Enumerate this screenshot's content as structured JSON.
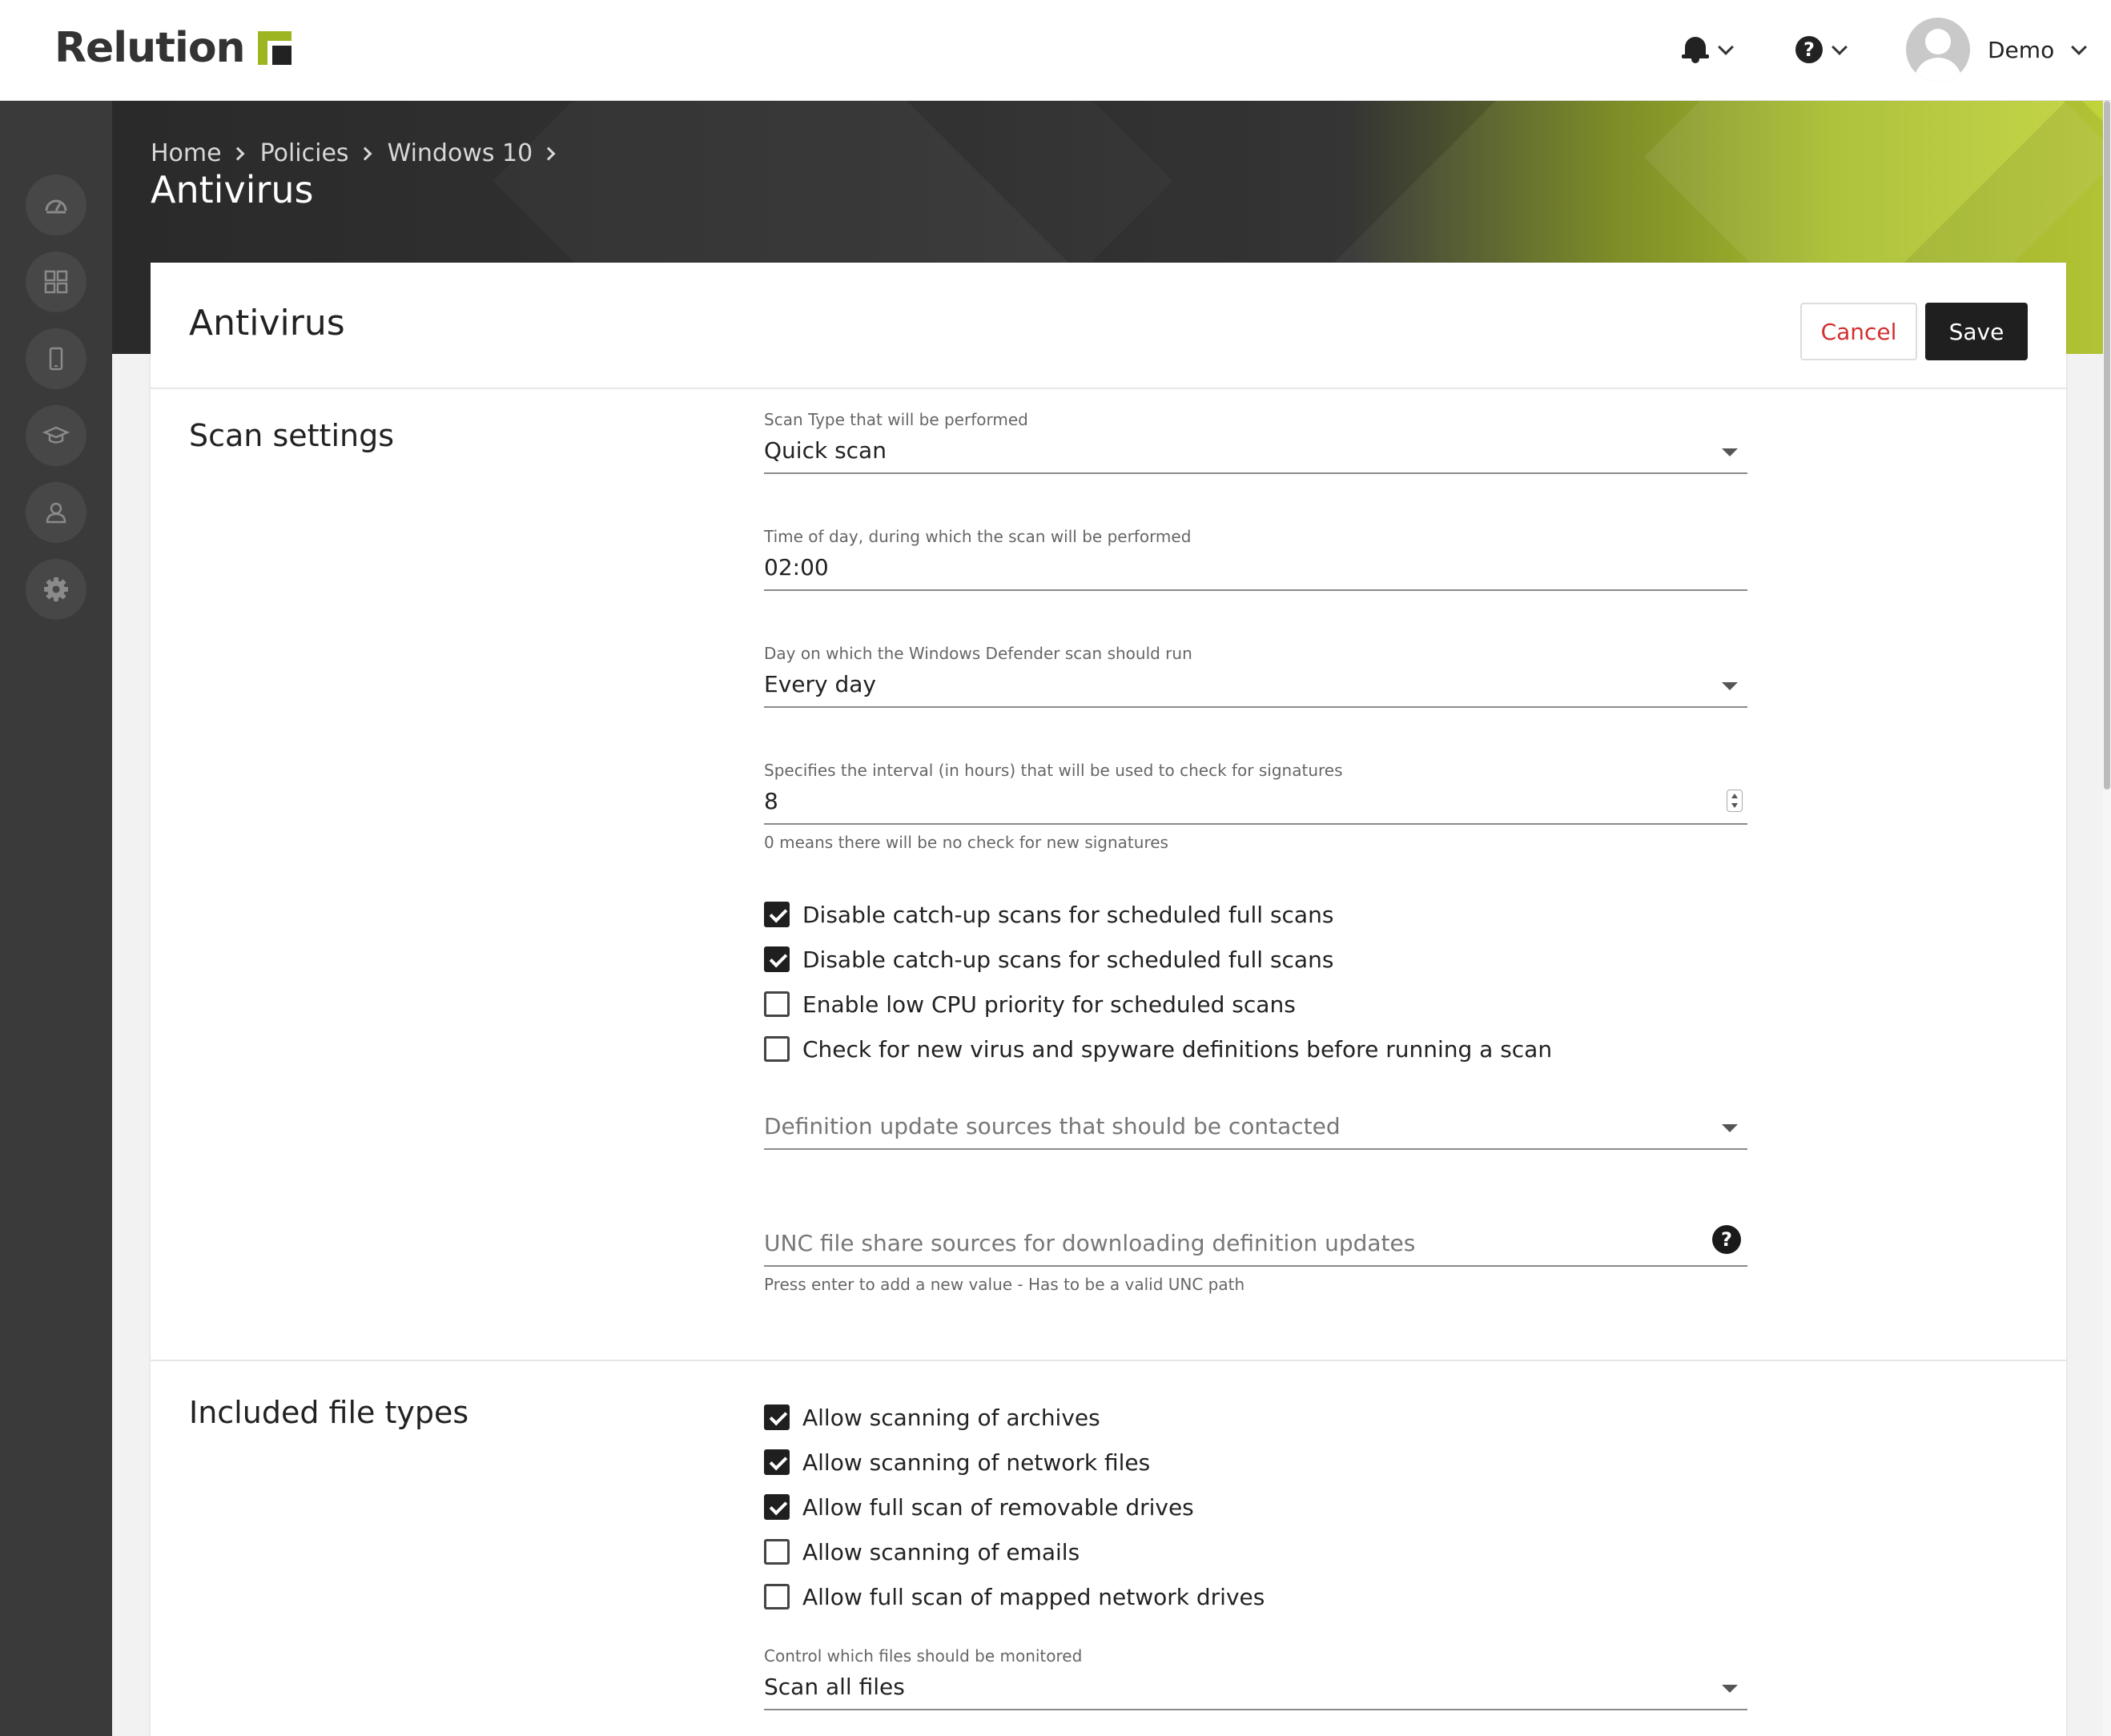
{
  "brand": {
    "name": "Relution"
  },
  "topbar": {
    "user_name": "Demo"
  },
  "breadcrumb": [
    "Home",
    "Policies",
    "Windows 10"
  ],
  "page_title": "Antivirus",
  "card": {
    "title": "Antivirus",
    "cancel_label": "Cancel",
    "save_label": "Save"
  },
  "scan_settings": {
    "title": "Scan settings",
    "scan_type": {
      "label": "Scan Type that will be performed",
      "value": "Quick scan"
    },
    "time_of_day": {
      "label": "Time of day, during which the scan will be performed",
      "value": "02:00"
    },
    "scan_day": {
      "label": "Day on which the Windows Defender scan should run",
      "value": "Every day"
    },
    "signature_interval": {
      "label": "Specifies the interval (in hours) that will be used to check for signatures",
      "value": "8",
      "hint": "0 means there will be no check for new signatures"
    },
    "checkboxes": [
      {
        "label": "Disable catch-up scans for scheduled full scans",
        "checked": true
      },
      {
        "label": "Disable catch-up scans for scheduled full scans",
        "checked": true
      },
      {
        "label": "Enable low CPU priority for scheduled scans",
        "checked": false
      },
      {
        "label": "Check for new virus and spyware definitions before running a scan",
        "checked": false
      }
    ],
    "update_sources": {
      "placeholder": "Definition update sources that should be contacted"
    },
    "unc_sources": {
      "placeholder": "UNC file share sources for downloading definition updates",
      "hint": "Press enter to add a new value - Has to be a valid UNC path"
    }
  },
  "included_file_types": {
    "title": "Included file types",
    "checkboxes": [
      {
        "label": "Allow scanning of archives",
        "checked": true
      },
      {
        "label": "Allow scanning of network files",
        "checked": true
      },
      {
        "label": "Allow full scan of removable drives",
        "checked": true
      },
      {
        "label": "Allow scanning of emails",
        "checked": false
      },
      {
        "label": "Allow full scan of mapped network drives",
        "checked": false
      }
    ],
    "monitor_files": {
      "label": "Control which files should be monitored",
      "value": "Scan all files"
    }
  },
  "icons": {
    "nav": [
      "dashboard-icon",
      "apps-icon",
      "device-icon",
      "education-icon",
      "user-icon",
      "settings-gear-icon"
    ],
    "topbar": [
      "notification-bell-icon",
      "help-question-icon",
      "user-avatar-icon"
    ]
  },
  "colors": {
    "brand_green": "#9cb520",
    "cancel_red": "#d32f2f",
    "save_dark": "#1f1f1f"
  }
}
